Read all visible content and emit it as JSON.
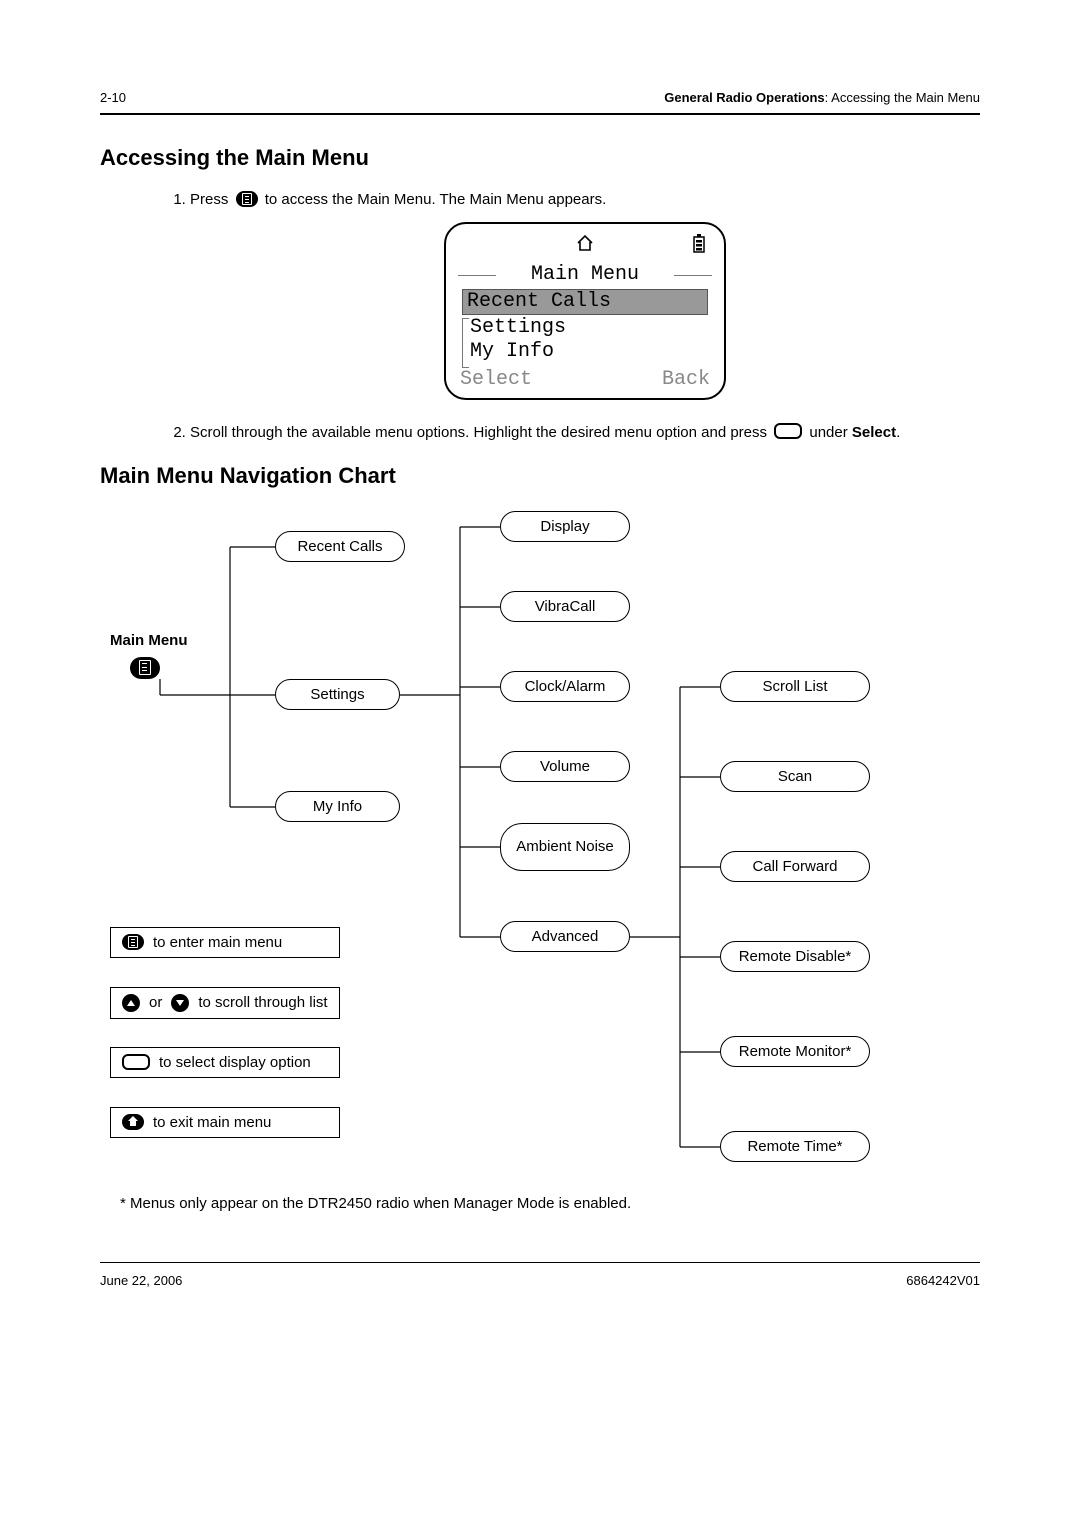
{
  "header": {
    "page_num": "2-10",
    "section_bold": "General Radio Operations",
    "section_rest": ": Accessing the Main Menu"
  },
  "section1": {
    "title": "Accessing the Main Menu",
    "step1_a": "Press",
    "step1_b": "to access the Main Menu. The Main Menu appears.",
    "step2_a": "Scroll through the available menu options. Highlight the desired menu option and press",
    "step2_b": "under",
    "step2_c": "Select",
    "step2_d": "."
  },
  "lcd": {
    "title": "Main Menu",
    "item1": "Recent Calls",
    "item2": "Settings",
    "item3": "My Info",
    "soft_left": "Select",
    "soft_right": "Back"
  },
  "section2": {
    "title": "Main Menu Navigation Chart",
    "main_menu_label": "Main Menu"
  },
  "chart_data": {
    "type": "tree",
    "root": "Main Menu",
    "level1": [
      "Recent Calls",
      "Settings",
      "My Info"
    ],
    "settings_children": [
      "Display",
      "VibraCall",
      "Clock/Alarm",
      "Volume",
      "Ambient Noise",
      "Advanced"
    ],
    "advanced_children": [
      "Scroll List",
      "Scan",
      "Call Forward",
      "Remote Disable*",
      "Remote Monitor*",
      "Remote Time*"
    ],
    "legend": [
      "to enter main menu",
      "to scroll through list",
      "to select display option",
      "to exit main menu"
    ],
    "legend_or": "or"
  },
  "footnote": "* Menus only appear on the DTR2450 radio when Manager Mode is enabled.",
  "footer": {
    "date": "June 22, 2006",
    "docnum": "6864242V01"
  }
}
